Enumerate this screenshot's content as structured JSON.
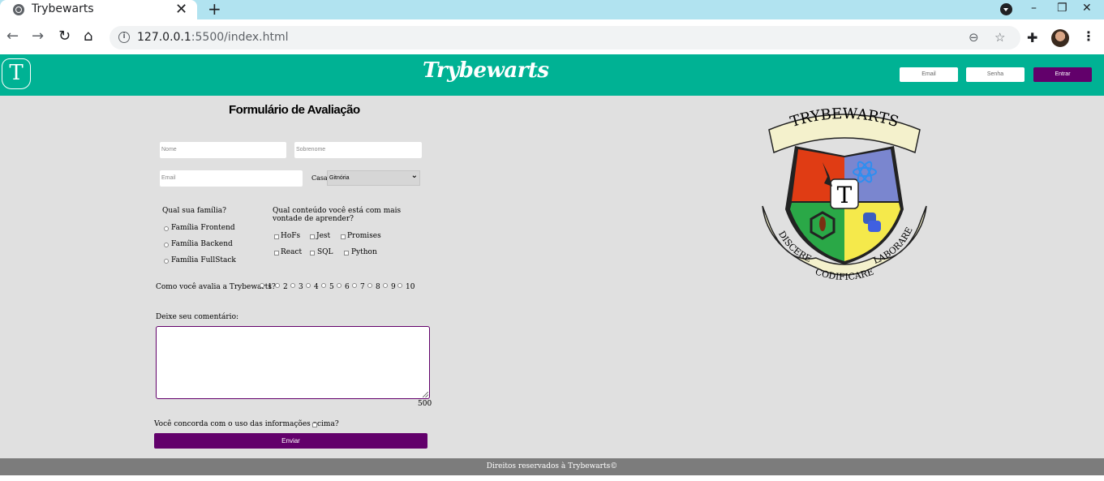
{
  "browser": {
    "tab_title": "Trybewarts",
    "tab_close": "✕",
    "new_tab": "+",
    "url_host": "127.0.0.1",
    "url_path": ":5500/index.html",
    "icons": [
      "globe-icon",
      "close-icon",
      "plus-icon",
      "back-icon",
      "forward-icon",
      "reload-icon",
      "home-icon",
      "info-icon",
      "zoom-icon",
      "star-icon",
      "extensions-icon",
      "kebab-menu-icon"
    ]
  },
  "header": {
    "logo_letter": "T",
    "title": "Trybewarts",
    "email_placeholder": "Email",
    "password_placeholder": "Senha",
    "login_label": "Entrar",
    "color": "#00b294"
  },
  "form": {
    "title": "Formulário de Avaliação",
    "name_placeholder": "Nome",
    "lastname_placeholder": "Sobrenome",
    "email_placeholder": "Email",
    "house_label": "Casa:",
    "house_selected": "Gitnória",
    "family_question": "Qual sua família?",
    "families": [
      "Família Frontend",
      "Família Backend",
      "Família FullStack"
    ],
    "content_question": "Qual conteúdo você está com mais vontade de aprender?",
    "contents": [
      "HoFs",
      "Jest",
      "Promises",
      "React",
      "SQL",
      "Python"
    ],
    "rating_question": "Como você avalia a Trybewarts?",
    "ratings": [
      "1",
      "2",
      "3",
      "4",
      "5",
      "6",
      "7",
      "8",
      "9",
      "10"
    ],
    "comment_label": "Deixe seu comentário:",
    "counter": "500",
    "agreement": "Você concorda com o uso das informações acima?",
    "submit_label": "Enviar",
    "accent_color": "#62006b"
  },
  "crest": {
    "top_banner": "TRYBEWARTS",
    "center_letter": "T",
    "left_motto": "DISCERE",
    "bottom_motto": "CODIFICARE",
    "right_motto": "LABORARE"
  },
  "footer": {
    "text": "Direitos reservados à Trybewarts©"
  }
}
